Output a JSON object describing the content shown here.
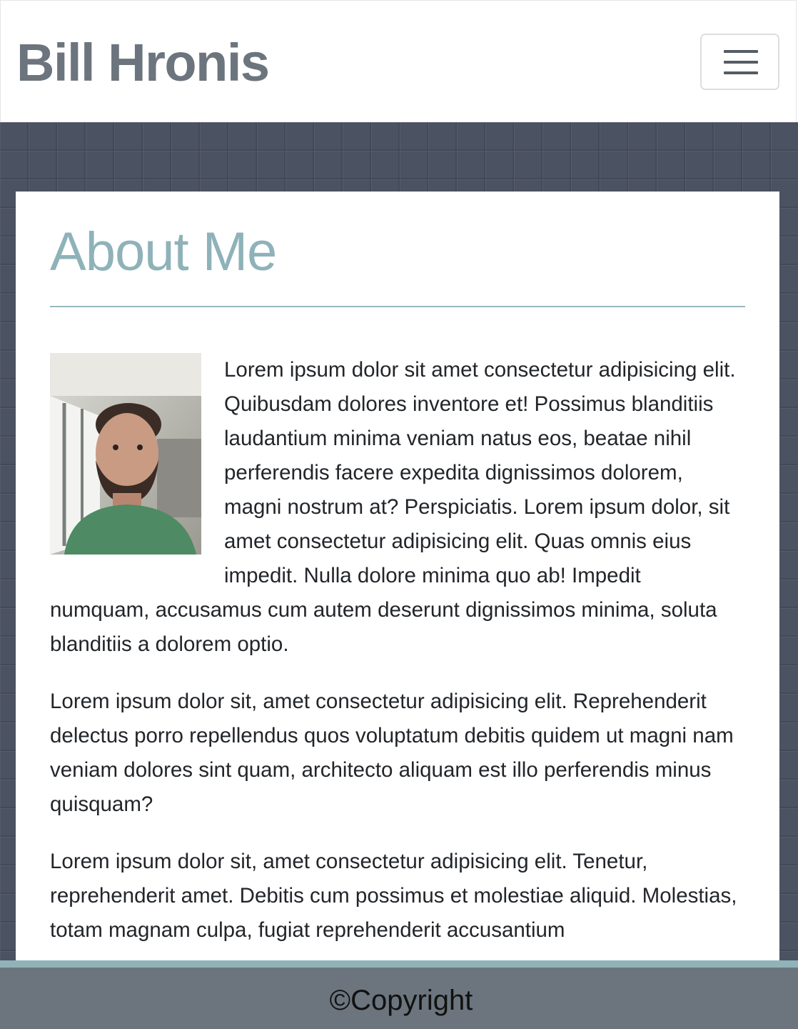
{
  "navbar": {
    "brand": "Bill Hronis",
    "toggler_icon": "hamburger-menu-icon"
  },
  "main": {
    "title": "About Me",
    "portrait_alt": "photo of Bill Hronis",
    "paragraphs": [
      "Lorem ipsum dolor sit amet consectetur adipisicing elit. Quibusdam dolores inventore et! Possimus blanditiis laudantium minima veniam natus eos, beatae nihil perferendis facere expedita dignissimos dolorem, magni nostrum at? Perspiciatis. Lorem ipsum dolor, sit amet consectetur adipisicing elit. Quas omnis eius impedit. Nulla dolore minima quo ab! Impedit numquam, accusamus cum autem deserunt dignissimos minima, soluta blanditiis a dolorem optio.",
      "Lorem ipsum dolor sit, amet consectetur adipisicing elit. Reprehenderit delectus porro repellendus quos voluptatum debitis quidem ut magni nam veniam dolores sint quam, architecto aliquam est illo perferendis minus quisquam?",
      "Lorem ipsum dolor sit, amet consectetur adipisicing elit. Tenetur, reprehenderit amet. Debitis cum possimus et molestiae aliquid. Molestias, totam magnam culpa, fugiat reprehenderit accusantium"
    ]
  },
  "footer": {
    "copyright": "©Copyright"
  },
  "colors": {
    "brand": "#6c757d",
    "heading": "#8fb2b9",
    "footer_bg": "#6c757d",
    "footer_accent": "#90b3b9",
    "page_bg": "#4b5261"
  }
}
